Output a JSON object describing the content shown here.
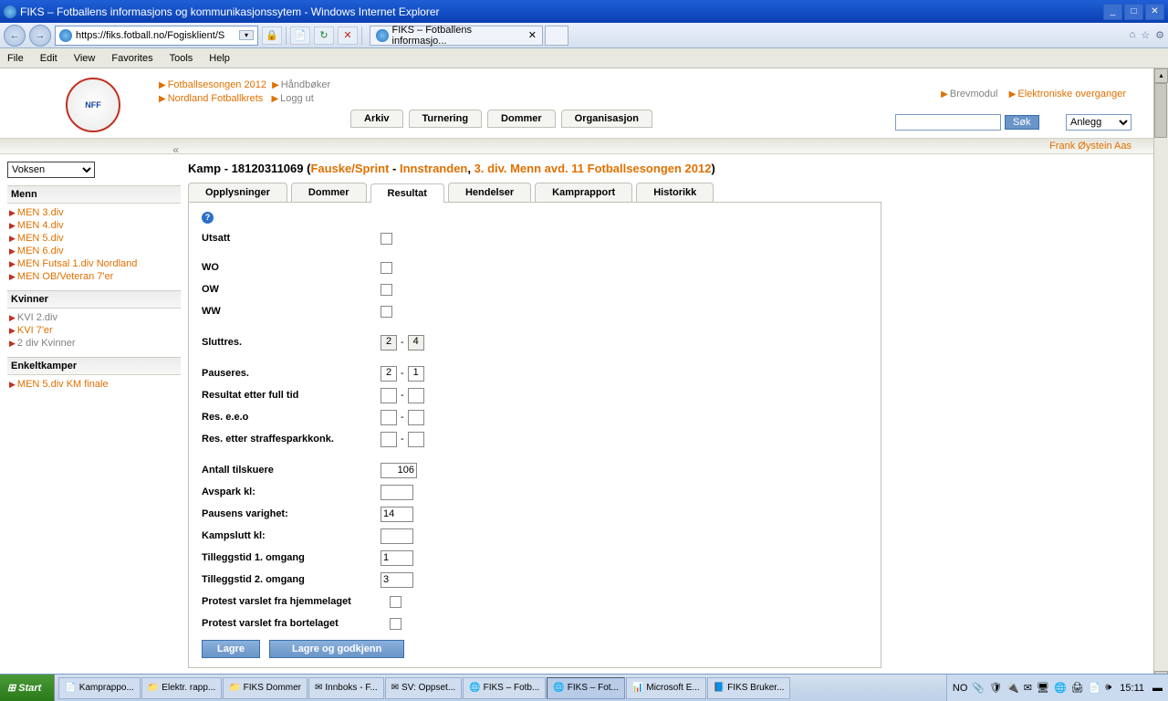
{
  "window": {
    "title": "FIKS – Fotballens informasjons og kommunikasjonssytem - Windows Internet Explorer"
  },
  "address": {
    "url": "https://fiks.fotball.no/Fogisklient/S"
  },
  "tab": {
    "title": "FIKS – Fotballens informasjo..."
  },
  "menu": {
    "file": "File",
    "edit": "Edit",
    "view": "View",
    "favorites": "Favorites",
    "tools": "Tools",
    "help": "Help"
  },
  "topnav": {
    "line1a": "Fotballsesongen 2012",
    "line1b": "Håndbøker",
    "line2a": "Nordland Fotballkrets",
    "line2b": "Logg ut",
    "right1": "Brevmodul",
    "right2": "Elektroniske overganger",
    "tabs": {
      "arkiv": "Arkiv",
      "turnering": "Turnering",
      "dommer": "Dommer",
      "organisasjon": "Organisasjon"
    },
    "sok": "Søk",
    "anlegg": "Anlegg"
  },
  "userbar": {
    "name": "Frank Øystein Aas"
  },
  "sidebar": {
    "voksen": "Voksen",
    "menn_hdr": "Menn",
    "menn": [
      "MEN 3.div",
      "MEN 4.div",
      "MEN 5.div",
      "MEN 6.div",
      "MEN Futsal 1.div Nordland",
      "MEN OB/Veteran 7'er"
    ],
    "kvinner_hdr": "Kvinner",
    "kvinner": [
      {
        "label": "KVI 2.div",
        "cls": "glink"
      },
      {
        "label": "KVI 7'er",
        "cls": "olink"
      },
      {
        "label": "2 div Kvinner",
        "cls": "glink"
      }
    ],
    "enkelt_hdr": "Enkeltkamper",
    "enkelt": [
      "MEN 5.div KM finale"
    ]
  },
  "kamp": {
    "prefix": "Kamp -  ",
    "id": "18120311069",
    "open": "  (",
    "team1": "Fauske/Sprint",
    "dash": "  -  ",
    "team2": "Innstranden",
    "comma": ",  ",
    "league": "3. div. Menn avd. 11 Fotballsesongen 2012",
    "close": ")"
  },
  "subtabs": {
    "oppl": "Opplysninger",
    "dommer": "Dommer",
    "resultat": "Resultat",
    "hendelser": "Hendelser",
    "kamprapport": "Kamprapport",
    "historikk": "Historikk"
  },
  "form": {
    "utsatt": "Utsatt",
    "wo": "WO",
    "ow": "OW",
    "ww": "WW",
    "sluttres": "Sluttres.",
    "sluttres_a": "2",
    "sluttres_b": "4",
    "pauseres": "Pauseres.",
    "pauseres_a": "2",
    "pauseres_b": "1",
    "fulltid": "Resultat etter full tid",
    "eeo": "Res. e.e.o",
    "straffe": "Res. etter straffesparkkonk.",
    "tilskuere": "Antall tilskuere",
    "tilskuere_v": "106",
    "avspark": "Avspark kl:",
    "pausevarig": "Pausens varighet:",
    "pausevarig_v": "14",
    "kampslutt": "Kampslutt kl:",
    "till1": "Tilleggstid 1. omgang",
    "till1_v": "1",
    "till2": "Tilleggstid 2. omgang",
    "till2_v": "3",
    "protest_h": "Protest varslet fra hjemmelaget",
    "protest_b": "Protest varslet fra bortelaget",
    "lagre": "Lagre",
    "lagre_god": "Lagre og godkjenn"
  },
  "taskbar": {
    "start": "Start",
    "items": [
      "Kamprappo...",
      "Elektr. rapp...",
      "FIKS Dommer",
      "Innboks - F...",
      "SV: Oppset...",
      "FIKS – Fotb...",
      "FIKS – Fot...",
      "Microsoft E...",
      "FIKS Bruker..."
    ],
    "lang": "NO",
    "clock": "15:11"
  }
}
